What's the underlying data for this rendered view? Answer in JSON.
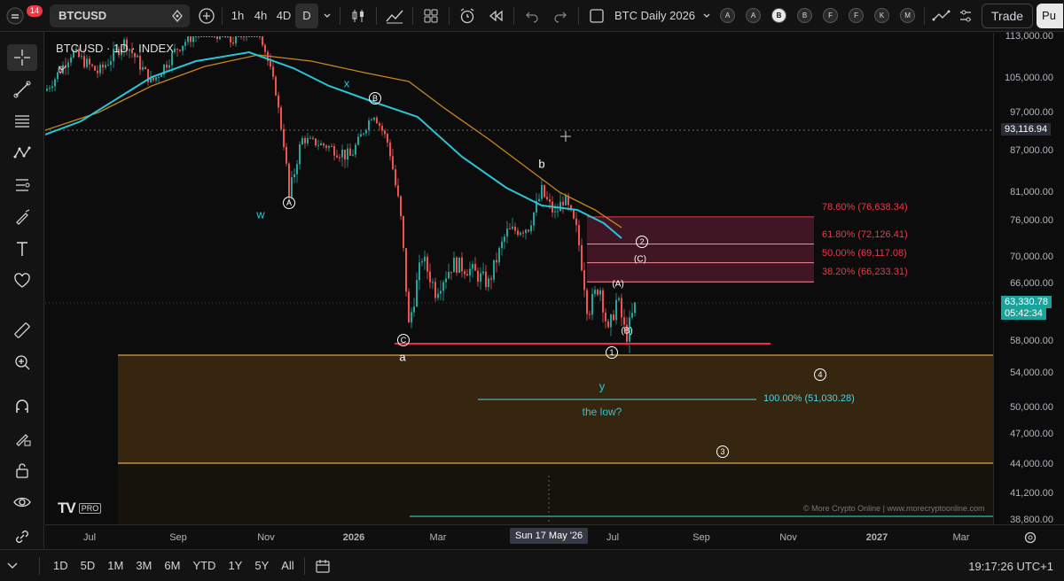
{
  "toolbar": {
    "notification_count": "14",
    "symbol": "BTCUSD",
    "intervals": [
      "1h",
      "4h",
      "4D",
      "D"
    ],
    "active_interval": "D",
    "layout_name": "BTC Daily 2026",
    "circle_buttons": [
      "A",
      "A",
      "B",
      "B",
      "F",
      "F",
      "K",
      "M"
    ],
    "trade_label": "Trade",
    "publish_label": "Pu"
  },
  "chart": {
    "legend_title": "BTCUSD · 1D · INDEX",
    "legend_sub": "6",
    "colors": {
      "background": "#0c0c0d",
      "up": "#26a69a",
      "down": "#ef5350",
      "ma_fast": "#29c5d6",
      "ma_slow": "#c8861f",
      "zone": "#3f2c10",
      "fib": "#f23645"
    },
    "wave_labels": {
      "w": "w",
      "x": "x",
      "b_lower": "b",
      "a_lower": "a",
      "y": "y",
      "A_circle": "A",
      "B_circle": "B",
      "C_circle": "C",
      "one": "1",
      "two": "2",
      "three": "3",
      "four": "4",
      "A_paren": "(A)",
      "B_paren": "(B)",
      "C_paren": "(C)"
    },
    "note": "the low?",
    "fib_levels": [
      {
        "label": "78.60% (76,638.34)",
        "price": 76638.34
      },
      {
        "label": "61.80% (72,126.41)",
        "price": 72126.41
      },
      {
        "label": "50.00% (69,117.08)",
        "price": 69117.08
      },
      {
        "label": "38.20% (66,233.31)",
        "price": 66233.31
      }
    ],
    "target_label": "100.00% (51,030.28)",
    "watermark": "© More Crypto Online | www.morecryptoonline.com",
    "logo": "TV",
    "logo_badge": "PRO"
  },
  "price_axis": {
    "ticks": [
      "113,000.00",
      "105,000.00",
      "97,000.00",
      "87,000.00",
      "81,000.00",
      "76,000.00",
      "70,000.00",
      "66,000.00",
      "58,000.00",
      "54,000.00",
      "50,000.00",
      "47,000.00",
      "44,000.00",
      "41,200.00",
      "38,800.00"
    ],
    "crosshair_price": "93,116.94",
    "last_price": "63,330.78",
    "countdown": "05:42:34"
  },
  "time_axis": {
    "ticks": [
      "Jul",
      "Sep",
      "Nov",
      "2026",
      "Mar",
      "Jul",
      "Sep",
      "Nov",
      "2027",
      "Mar"
    ],
    "cursor_date": "Sun 17 May '26"
  },
  "bottom": {
    "ranges": [
      "1D",
      "5D",
      "1M",
      "3M",
      "6M",
      "YTD",
      "1Y",
      "5Y",
      "All"
    ],
    "clock": "19:17:26 UTC+1"
  }
}
